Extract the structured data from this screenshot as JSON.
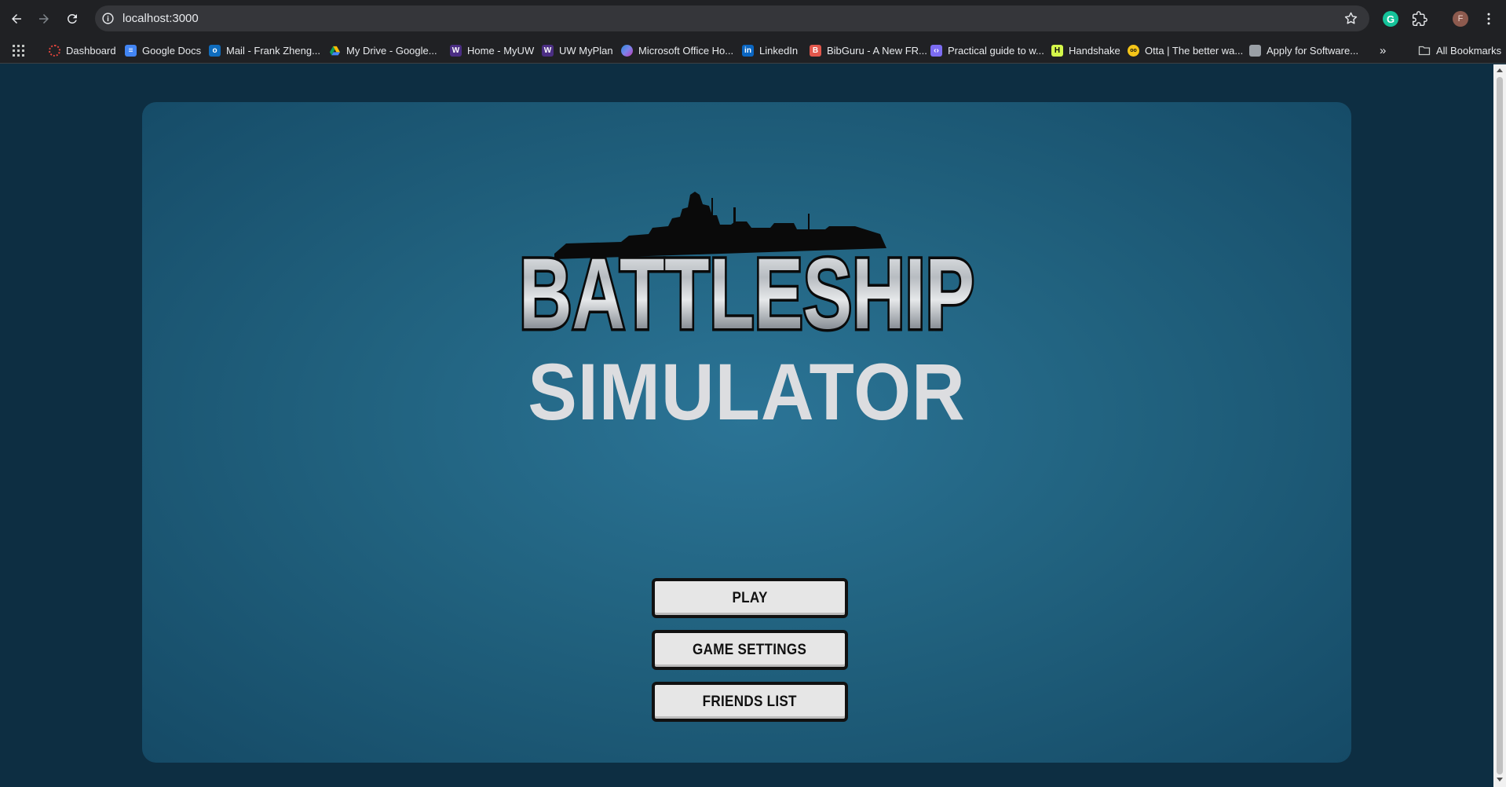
{
  "browser": {
    "url": "localhost:3000",
    "profile_initial": "F",
    "all_bookmarks_label": "All Bookmarks",
    "bookmarks": [
      {
        "label": "Dashboard",
        "icon": "dashboard-icon",
        "color": "#e2453c"
      },
      {
        "label": "Google Docs",
        "icon": "google-docs-icon",
        "color": "#4285f4"
      },
      {
        "label": "Mail - Frank Zheng...",
        "icon": "outlook-icon",
        "color": "#0f6cbd"
      },
      {
        "label": "My Drive - Google...",
        "icon": "google-drive-icon",
        "color": "#fbbc04"
      },
      {
        "label": "Home - MyUW",
        "icon": "uw-icon",
        "color": "#4b2e83"
      },
      {
        "label": "UW MyPlan",
        "icon": "uw-icon",
        "color": "#4b2e83"
      },
      {
        "label": "Microsoft Office Ho...",
        "icon": "office-icon",
        "color": "#7b83eb"
      },
      {
        "label": "LinkedIn",
        "icon": "linkedin-icon",
        "color": "#0a66c2"
      },
      {
        "label": "BibGuru - A New FR...",
        "icon": "bibguru-icon",
        "color": "#e2574c"
      },
      {
        "label": "Practical guide to w...",
        "icon": "code-icon",
        "color": "#7c6cf2"
      },
      {
        "label": "Handshake",
        "icon": "handshake-icon",
        "color": "#d4f74a"
      },
      {
        "label": "Otta | The better wa...",
        "icon": "otta-icon",
        "color": "#f5c518"
      },
      {
        "label": "Apply for Software...",
        "icon": "page-icon",
        "color": "#9aa0a6"
      }
    ]
  },
  "page": {
    "logo_text": "BATTLESHIP",
    "subtitle": "SIMULATOR",
    "buttons": {
      "play": "PLAY",
      "settings": "GAME SETTINGS",
      "friends": "FRIENDS LIST"
    }
  },
  "colors": {
    "panel_center": "#2b7496",
    "panel_edge": "#154a66",
    "page_background": "#0d2e42"
  }
}
